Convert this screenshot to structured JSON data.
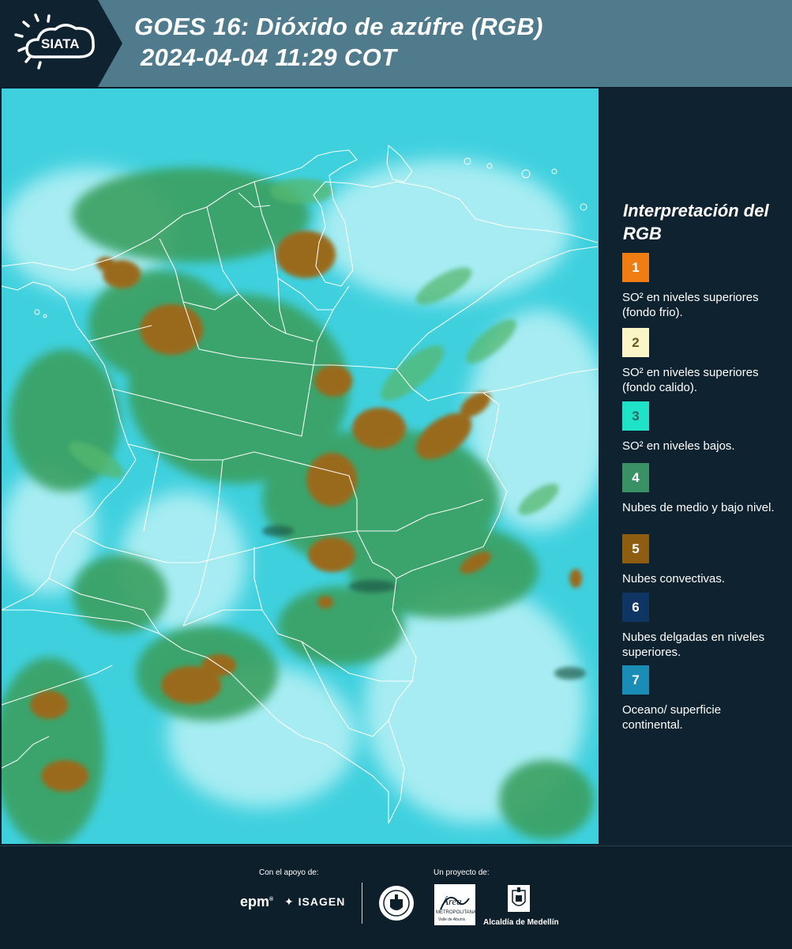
{
  "header": {
    "logo_text": "SIATA",
    "title_line1": "GOES 16: Dióxido de azúfre (RGB)",
    "title_line2": "2024-04-04 11:29 COT",
    "bg_color": "#507b8c",
    "logo_bg_color": "#0f2230"
  },
  "map": {
    "ocean_color": "#3fd0de",
    "boundary_color": "#ffffff",
    "icon": "satellite-map"
  },
  "legend": {
    "title": "Interpretación del RGB",
    "items": [
      {
        "number": "1",
        "color": "#f07c14",
        "text": "SO² en niveles superiores (fondo frio)."
      },
      {
        "number": "2",
        "color": "#fbf6c7",
        "text": "SO² en niveles superiores (fondo calido)."
      },
      {
        "number": "3",
        "color": "#1fe3c9",
        "text": "SO² en niveles bajos."
      },
      {
        "number": "4",
        "color": "#3a9166",
        "text": "Nubes de medio y bajo nivel."
      },
      {
        "number": "5",
        "color": "#8f5d12",
        "text": "Nubes convectivas."
      },
      {
        "number": "6",
        "color": "#0f3564",
        "text": "Nubes delgadas en niveles superiores."
      },
      {
        "number": "7",
        "color": "#1b8cb6",
        "text": "Oceano/ superficie continental."
      }
    ]
  },
  "footer": {
    "support_label": "Con el apoyo de:",
    "project_label": "Un proyecto de:",
    "epm": "epm",
    "isagen": "ISAGEN",
    "area_name": "Área",
    "area_sub": "METROPOLITANA",
    "area_sub2": "Valle de Aburrá",
    "alcaldia": "Alcaldía de Medellín"
  }
}
